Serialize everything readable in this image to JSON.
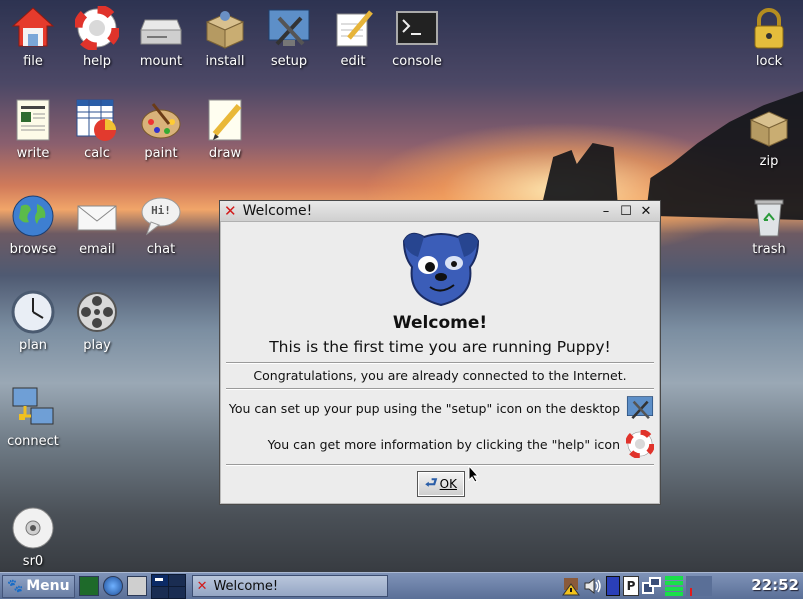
{
  "desktop": {
    "icons": [
      {
        "label": "file"
      },
      {
        "label": "help"
      },
      {
        "label": "mount"
      },
      {
        "label": "install"
      },
      {
        "label": "setup"
      },
      {
        "label": "edit"
      },
      {
        "label": "console"
      },
      {
        "label": "lock"
      },
      {
        "label": "write"
      },
      {
        "label": "calc"
      },
      {
        "label": "paint"
      },
      {
        "label": "draw"
      },
      {
        "label": "zip"
      },
      {
        "label": "browse"
      },
      {
        "label": "email"
      },
      {
        "label": "chat"
      },
      {
        "label": "trash"
      },
      {
        "label": "plan"
      },
      {
        "label": "play"
      },
      {
        "label": "connect"
      },
      {
        "label": "sr0"
      }
    ],
    "chat_bubble_text": "Hi!"
  },
  "dialog": {
    "title": "Welcome!",
    "heading": "Welcome!",
    "subheading": "This is the first time you are running Puppy!",
    "connected_text": "Congratulations, you are already connected to the Internet.",
    "setup_text": "You can set up your pup using the \"setup\" icon on the desktop",
    "help_text": "You can get more information by clicking the \"help\" icon",
    "ok_label": "OK"
  },
  "taskbar": {
    "menu_label": "Menu",
    "task_label": "Welcome!",
    "clock": "22:52",
    "tray_badge": "P"
  },
  "colors": {
    "taskbar": "#6a7ea4",
    "dialog_bg": "#ececec",
    "close_x": "#d21b1b"
  }
}
